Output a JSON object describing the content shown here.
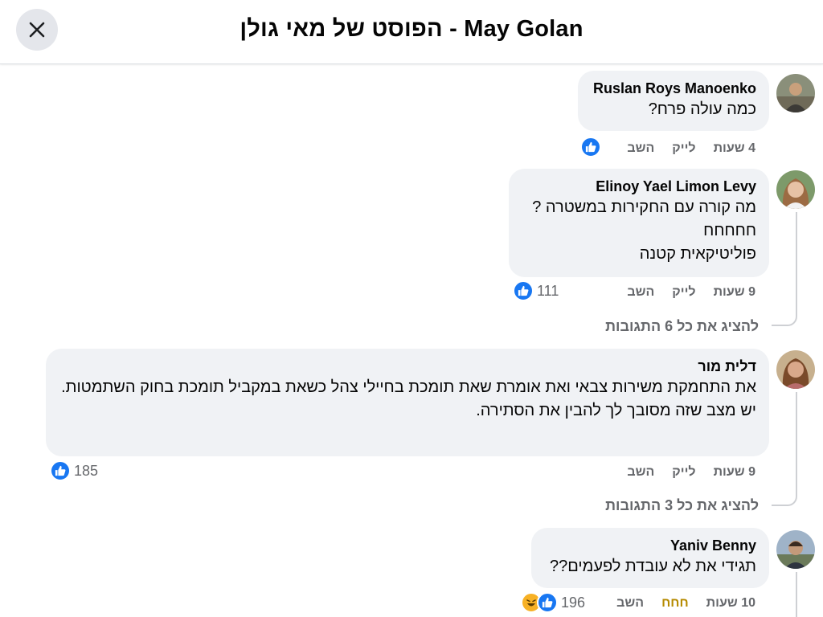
{
  "header": {
    "title": "הפוסט של מאי גולן - May Golan",
    "close_icon": "close-icon"
  },
  "comments": [
    {
      "author": "Ruslan Roys Manoenko",
      "lines": [
        "כמה עולה פרח?"
      ],
      "time": "4 שעות",
      "like_label": "לייק",
      "reply_label": "השב",
      "reaction_count": "",
      "avatar_icon": "avatar-photo"
    },
    {
      "author": "Elinoy Yael Limon Levy",
      "lines": [
        "מה קורה עם החקירות במשטרה ?",
        "חחחחח",
        "פוליטיקאית קטנה"
      ],
      "time": "9 שעות",
      "like_label": "לייק",
      "reply_label": "השב",
      "reaction_count": "111",
      "view_replies": "להציג את כל 6 התגובות",
      "avatar_icon": "avatar-photo"
    },
    {
      "author": "דלית מור",
      "lines": [
        "את התחמקת משירות צבאי ואת אומרת שאת תומכת בחיילי צהל כשאת במקביל תומכת בחוק השתמטות.",
        "יש מצב שזה מסובך לך להבין את הסתירה."
      ],
      "time": "9 שעות",
      "like_label": "לייק",
      "reply_label": "השב",
      "reaction_count": "185",
      "view_replies": "להציג את כל 3 התגובות",
      "avatar_icon": "avatar-photo"
    },
    {
      "author": "Yaniv Benny",
      "lines": [
        "תגידי את לא עובדת לפעמים??"
      ],
      "time": "10 שעות",
      "like_label": "חחח",
      "reply_label": "השב",
      "reaction_count": "196",
      "avatar_icon": "avatar-photo"
    }
  ],
  "colors": {
    "like_blue": "#1877f2",
    "bubble_bg": "#f0f2f5",
    "meta_gray": "#65676b",
    "haha_yellow": "#f7b125"
  }
}
